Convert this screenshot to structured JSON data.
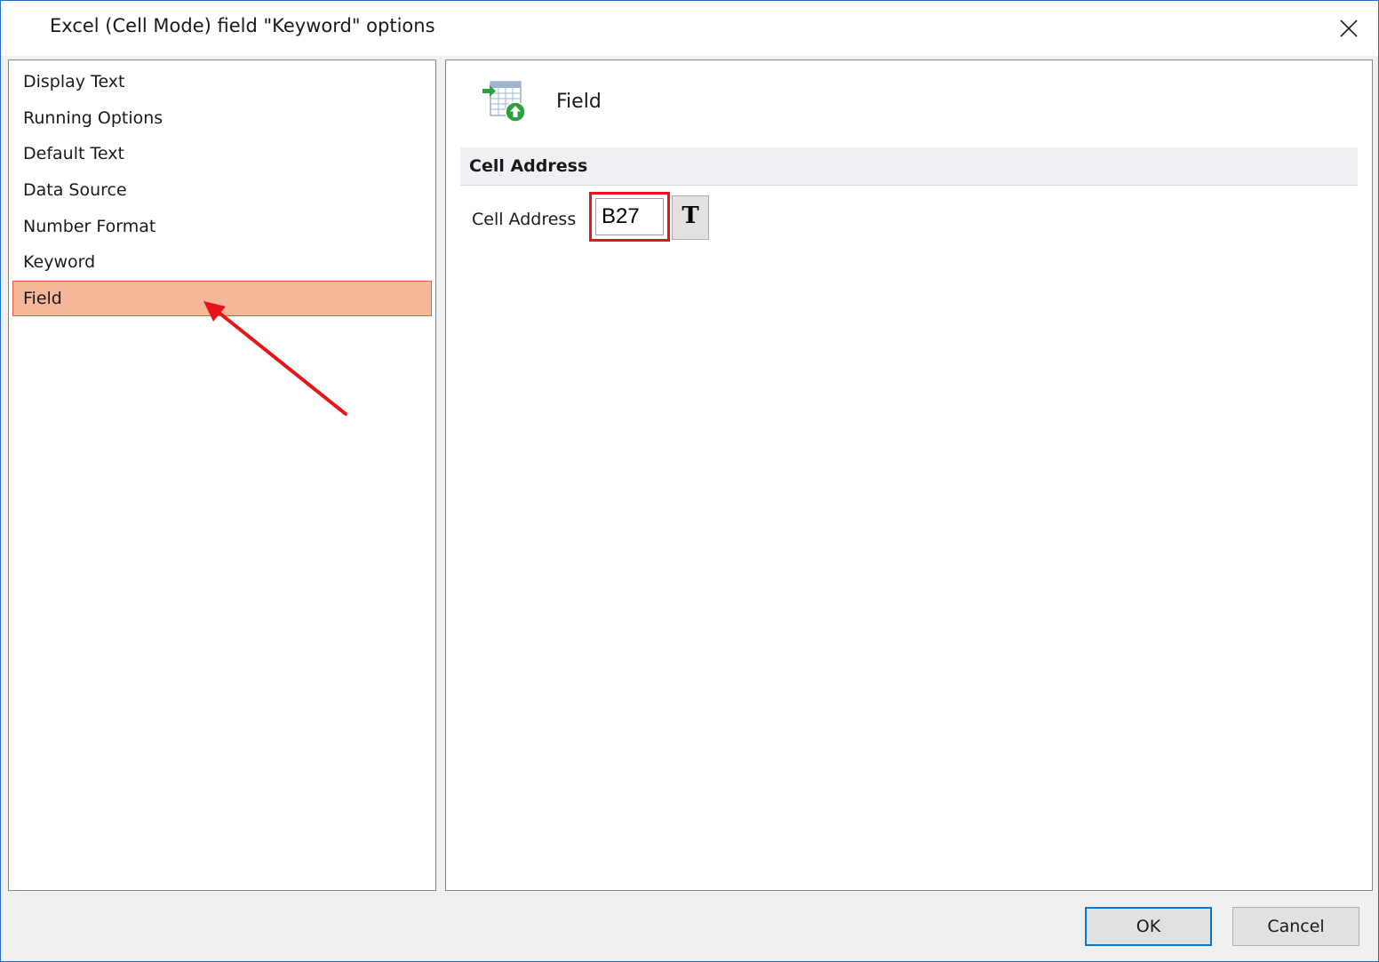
{
  "window": {
    "title": "Excel (Cell Mode) field \"Keyword\" options"
  },
  "sidebar": {
    "items": [
      {
        "label": "Display Text"
      },
      {
        "label": "Running Options"
      },
      {
        "label": "Default Text"
      },
      {
        "label": "Data Source"
      },
      {
        "label": "Number Format"
      },
      {
        "label": "Keyword"
      },
      {
        "label": "Field",
        "selected": true
      }
    ]
  },
  "main": {
    "heading": "Field",
    "icon": "field-table-icon",
    "group": {
      "title": "Cell Address",
      "cell_label": "Cell Address",
      "cell_value": "B27",
      "text_button_label": "T"
    }
  },
  "footer": {
    "ok_label": "OK",
    "cancel_label": "Cancel"
  },
  "colors": {
    "selected_bg": "#f5b79a",
    "selected_border": "#e05a3c",
    "annotation_red": "#e8141a",
    "accent": "#0078d7"
  }
}
